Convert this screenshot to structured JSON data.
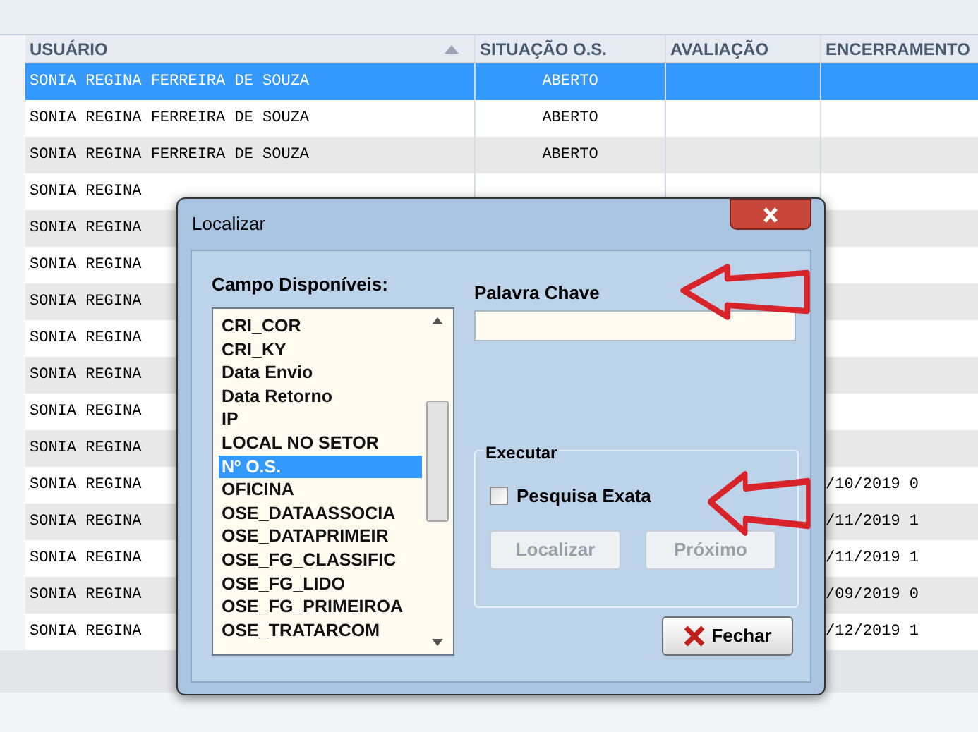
{
  "grid": {
    "columns": [
      {
        "label": "USUÁRIO",
        "sorted": true
      },
      {
        "label": "SITUAÇÃO O.S.",
        "sorted": false
      },
      {
        "label": "AVALIAÇÃO",
        "sorted": false
      },
      {
        "label": "ENCERRAMENTO",
        "sorted": false
      }
    ],
    "rows": [
      {
        "user": "SONIA REGINA FERREIRA DE SOUZA",
        "status": "ABERTO",
        "closed": "",
        "selected": true
      },
      {
        "user": "SONIA REGINA FERREIRA DE SOUZA",
        "status": "ABERTO",
        "closed": "",
        "selected": false
      },
      {
        "user": "SONIA REGINA FERREIRA DE SOUZA",
        "status": "ABERTO",
        "closed": "",
        "selected": false
      },
      {
        "user": "SONIA REGINA",
        "status": "",
        "closed": "",
        "selected": false
      },
      {
        "user": "SONIA REGINA",
        "status": "",
        "closed": "",
        "selected": false
      },
      {
        "user": "SONIA REGINA",
        "status": "",
        "closed": "",
        "selected": false
      },
      {
        "user": "SONIA REGINA",
        "status": "",
        "closed": "",
        "selected": false
      },
      {
        "user": "SONIA REGINA",
        "status": "",
        "closed": "",
        "selected": false
      },
      {
        "user": "SONIA REGINA",
        "status": "",
        "closed": "",
        "selected": false
      },
      {
        "user": "SONIA REGINA",
        "status": "",
        "closed": "",
        "selected": false
      },
      {
        "user": "SONIA REGINA",
        "status": "",
        "closed": "",
        "selected": false
      },
      {
        "user": "SONIA REGINA",
        "status": "",
        "closed": "/10/2019 0",
        "selected": false
      },
      {
        "user": "SONIA REGINA",
        "status": "",
        "closed": "/11/2019 1",
        "selected": false
      },
      {
        "user": "SONIA REGINA",
        "status": "",
        "closed": "/11/2019 1",
        "selected": false
      },
      {
        "user": "SONIA REGINA",
        "status": "",
        "closed": "/09/2019 0",
        "selected": false
      },
      {
        "user": "SONIA REGINA",
        "status": "",
        "closed": "/12/2019 1",
        "selected": false
      }
    ]
  },
  "dialog": {
    "title": "Localizar",
    "fields_label": "Campo Disponíveis:",
    "fields": [
      {
        "label": "CRI_COR",
        "selected": false
      },
      {
        "label": "CRI_KY",
        "selected": false
      },
      {
        "label": "Data Envio",
        "selected": false
      },
      {
        "label": "Data Retorno",
        "selected": false
      },
      {
        "label": "IP",
        "selected": false
      },
      {
        "label": "LOCAL NO SETOR",
        "selected": false
      },
      {
        "label": "Nº O.S.",
        "selected": true
      },
      {
        "label": "OFICINA",
        "selected": false
      },
      {
        "label": "OSE_DATAASSOCIA",
        "selected": false
      },
      {
        "label": "OSE_DATAPRIMEIR",
        "selected": false
      },
      {
        "label": "OSE_FG_CLASSIFIC",
        "selected": false
      },
      {
        "label": "OSE_FG_LIDO",
        "selected": false
      },
      {
        "label": "OSE_FG_PRIMEIROA",
        "selected": false
      },
      {
        "label": "OSE_TRATARCOM",
        "selected": false
      }
    ],
    "keyword_label": "Palavra Chave",
    "group_title": "Executar",
    "exact": {
      "label": "Pesquisa Exata",
      "checked": false
    },
    "buttons": [
      {
        "label": "Localizar",
        "disabled": true,
        "kind": "plain"
      },
      {
        "label": "Próximo",
        "disabled": true,
        "kind": "plain"
      },
      {
        "label": "Fechar",
        "disabled": false,
        "kind": "close"
      }
    ]
  }
}
